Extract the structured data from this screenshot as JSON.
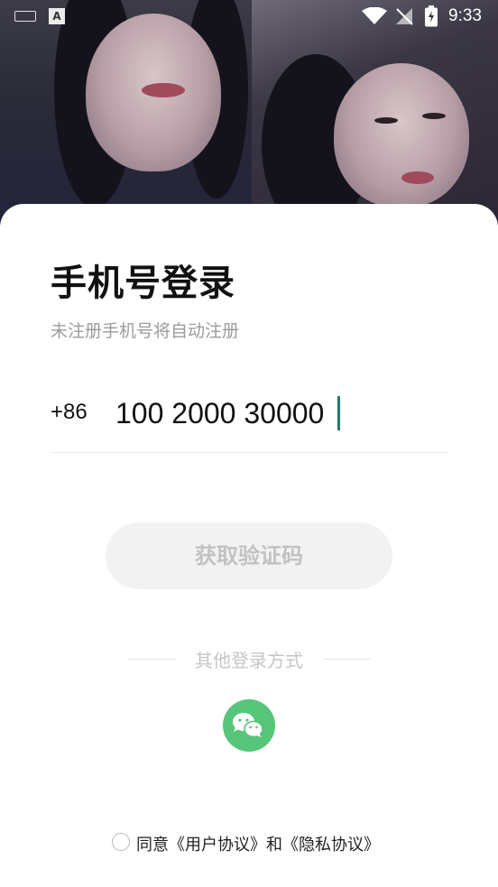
{
  "status_bar": {
    "time": "9:33",
    "icons": [
      "keyboard-icon",
      "app-notification-icon",
      "wifi-icon",
      "no-sim-icon",
      "battery-charging-icon"
    ]
  },
  "login": {
    "title": "手机号登录",
    "subtitle": "未注册手机号将自动注册",
    "country_code": "+86",
    "phone_value": "100 2000 30000",
    "get_code_label": "获取验证码",
    "get_code_enabled": false,
    "other_methods_label": "其他登录方式",
    "other_methods": [
      {
        "icon": "wechat-icon",
        "color": "#57c57a"
      }
    ]
  },
  "agreement": {
    "agree_prefix": "同意",
    "user_agreement": "《用户协议》",
    "and": "和",
    "privacy_agreement": "《隐私协议》",
    "checked": false
  },
  "colors": {
    "accent": "#57c57a",
    "caret": "#1f7a6e",
    "disabled_button_bg": "#f2f2f2",
    "disabled_button_text": "#c2c2c2"
  }
}
